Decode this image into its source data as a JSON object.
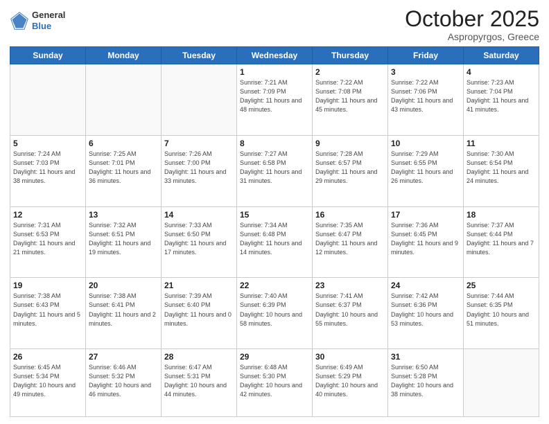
{
  "header": {
    "logo_general": "General",
    "logo_blue": "Blue",
    "month_title": "October 2025",
    "location": "Aspropyrgos, Greece"
  },
  "days_of_week": [
    "Sunday",
    "Monday",
    "Tuesday",
    "Wednesday",
    "Thursday",
    "Friday",
    "Saturday"
  ],
  "weeks": [
    [
      {
        "day": "",
        "info": ""
      },
      {
        "day": "",
        "info": ""
      },
      {
        "day": "",
        "info": ""
      },
      {
        "day": "1",
        "info": "Sunrise: 7:21 AM\nSunset: 7:09 PM\nDaylight: 11 hours and 48 minutes."
      },
      {
        "day": "2",
        "info": "Sunrise: 7:22 AM\nSunset: 7:08 PM\nDaylight: 11 hours and 45 minutes."
      },
      {
        "day": "3",
        "info": "Sunrise: 7:22 AM\nSunset: 7:06 PM\nDaylight: 11 hours and 43 minutes."
      },
      {
        "day": "4",
        "info": "Sunrise: 7:23 AM\nSunset: 7:04 PM\nDaylight: 11 hours and 41 minutes."
      }
    ],
    [
      {
        "day": "5",
        "info": "Sunrise: 7:24 AM\nSunset: 7:03 PM\nDaylight: 11 hours and 38 minutes."
      },
      {
        "day": "6",
        "info": "Sunrise: 7:25 AM\nSunset: 7:01 PM\nDaylight: 11 hours and 36 minutes."
      },
      {
        "day": "7",
        "info": "Sunrise: 7:26 AM\nSunset: 7:00 PM\nDaylight: 11 hours and 33 minutes."
      },
      {
        "day": "8",
        "info": "Sunrise: 7:27 AM\nSunset: 6:58 PM\nDaylight: 11 hours and 31 minutes."
      },
      {
        "day": "9",
        "info": "Sunrise: 7:28 AM\nSunset: 6:57 PM\nDaylight: 11 hours and 29 minutes."
      },
      {
        "day": "10",
        "info": "Sunrise: 7:29 AM\nSunset: 6:55 PM\nDaylight: 11 hours and 26 minutes."
      },
      {
        "day": "11",
        "info": "Sunrise: 7:30 AM\nSunset: 6:54 PM\nDaylight: 11 hours and 24 minutes."
      }
    ],
    [
      {
        "day": "12",
        "info": "Sunrise: 7:31 AM\nSunset: 6:53 PM\nDaylight: 11 hours and 21 minutes."
      },
      {
        "day": "13",
        "info": "Sunrise: 7:32 AM\nSunset: 6:51 PM\nDaylight: 11 hours and 19 minutes."
      },
      {
        "day": "14",
        "info": "Sunrise: 7:33 AM\nSunset: 6:50 PM\nDaylight: 11 hours and 17 minutes."
      },
      {
        "day": "15",
        "info": "Sunrise: 7:34 AM\nSunset: 6:48 PM\nDaylight: 11 hours and 14 minutes."
      },
      {
        "day": "16",
        "info": "Sunrise: 7:35 AM\nSunset: 6:47 PM\nDaylight: 11 hours and 12 minutes."
      },
      {
        "day": "17",
        "info": "Sunrise: 7:36 AM\nSunset: 6:45 PM\nDaylight: 11 hours and 9 minutes."
      },
      {
        "day": "18",
        "info": "Sunrise: 7:37 AM\nSunset: 6:44 PM\nDaylight: 11 hours and 7 minutes."
      }
    ],
    [
      {
        "day": "19",
        "info": "Sunrise: 7:38 AM\nSunset: 6:43 PM\nDaylight: 11 hours and 5 minutes."
      },
      {
        "day": "20",
        "info": "Sunrise: 7:38 AM\nSunset: 6:41 PM\nDaylight: 11 hours and 2 minutes."
      },
      {
        "day": "21",
        "info": "Sunrise: 7:39 AM\nSunset: 6:40 PM\nDaylight: 11 hours and 0 minutes."
      },
      {
        "day": "22",
        "info": "Sunrise: 7:40 AM\nSunset: 6:39 PM\nDaylight: 10 hours and 58 minutes."
      },
      {
        "day": "23",
        "info": "Sunrise: 7:41 AM\nSunset: 6:37 PM\nDaylight: 10 hours and 55 minutes."
      },
      {
        "day": "24",
        "info": "Sunrise: 7:42 AM\nSunset: 6:36 PM\nDaylight: 10 hours and 53 minutes."
      },
      {
        "day": "25",
        "info": "Sunrise: 7:44 AM\nSunset: 6:35 PM\nDaylight: 10 hours and 51 minutes."
      }
    ],
    [
      {
        "day": "26",
        "info": "Sunrise: 6:45 AM\nSunset: 5:34 PM\nDaylight: 10 hours and 49 minutes."
      },
      {
        "day": "27",
        "info": "Sunrise: 6:46 AM\nSunset: 5:32 PM\nDaylight: 10 hours and 46 minutes."
      },
      {
        "day": "28",
        "info": "Sunrise: 6:47 AM\nSunset: 5:31 PM\nDaylight: 10 hours and 44 minutes."
      },
      {
        "day": "29",
        "info": "Sunrise: 6:48 AM\nSunset: 5:30 PM\nDaylight: 10 hours and 42 minutes."
      },
      {
        "day": "30",
        "info": "Sunrise: 6:49 AM\nSunset: 5:29 PM\nDaylight: 10 hours and 40 minutes."
      },
      {
        "day": "31",
        "info": "Sunrise: 6:50 AM\nSunset: 5:28 PM\nDaylight: 10 hours and 38 minutes."
      },
      {
        "day": "",
        "info": ""
      }
    ]
  ]
}
